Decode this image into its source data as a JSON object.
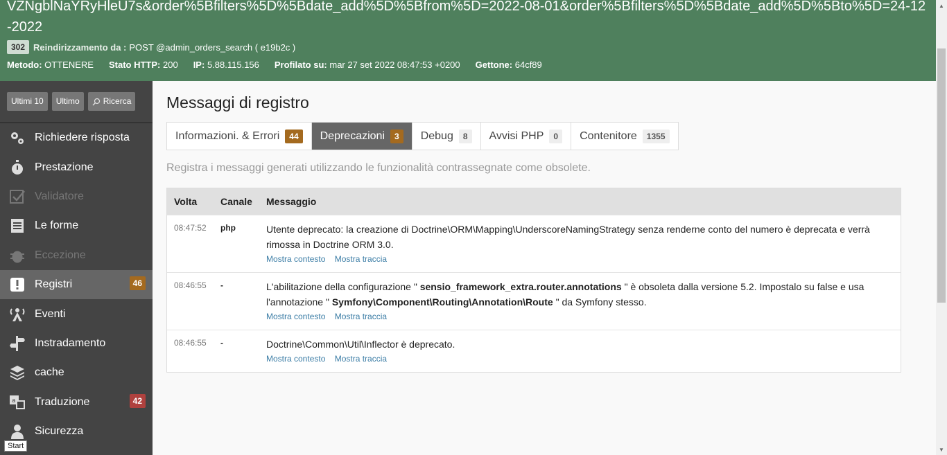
{
  "header": {
    "url": "VZNgblNaYRyHleU7s&order%5Bfilters%5D%5Bdate_add%5D%5Bfrom%5D=2022-08-01&order%5Bfilters%5D%5Bdate_add%5D%5Bto%5D=24-12-2022",
    "status_code": "302",
    "redirect_label": "Reindirizzamento da :",
    "redirect_value": "POST @admin_orders_search ( e19b2c )",
    "method_label": "Metodo:",
    "method_value": "OTTENERE",
    "http_label": "Stato HTTP:",
    "http_value": "200",
    "ip_label": "IP:",
    "ip_value": "5.88.115.156",
    "profiled_label": "Profilato su:",
    "profiled_value": "mar 27 set 2022 08:47:53 +0200",
    "token_label": "Gettone:",
    "token_value": "64cf89"
  },
  "sidebar": {
    "buttons": {
      "last10": "Ultimi 10",
      "latest": "Ultimo",
      "search": "Ricerca"
    },
    "items": [
      {
        "label": "Richiedere risposta",
        "icon": "gears-icon"
      },
      {
        "label": "Prestazione",
        "icon": "stopwatch-icon"
      },
      {
        "label": "Validatore",
        "icon": "checkbox-icon",
        "disabled": true
      },
      {
        "label": "Le forme",
        "icon": "form-icon"
      },
      {
        "label": "Eccezione",
        "icon": "bug-icon",
        "disabled": true
      },
      {
        "label": "Registri",
        "icon": "exclamation-icon",
        "count": "46",
        "active": true
      },
      {
        "label": "Eventi",
        "icon": "events-icon"
      },
      {
        "label": "Instradamento",
        "icon": "signpost-icon"
      },
      {
        "label": "cache",
        "icon": "layers-icon"
      },
      {
        "label": "Traduzione",
        "icon": "translate-icon",
        "count": "42"
      },
      {
        "label": "Sicurezza",
        "icon": "person-icon"
      }
    ],
    "start_tooltip": "Start"
  },
  "main": {
    "title": "Messaggi di registro",
    "tabs": [
      {
        "label": "Informazioni. & Errori",
        "count": "44"
      },
      {
        "label": "Deprecazioni",
        "count": "3"
      },
      {
        "label": "Debug",
        "count": "8"
      },
      {
        "label": "Avvisi PHP",
        "count": "0"
      },
      {
        "label": "Contenitore",
        "count": "1355"
      }
    ],
    "description": "Registra i messaggi generati utilizzando le funzionalità contrassegnate come obsolete.",
    "table": {
      "headers": {
        "time": "Volta",
        "channel": "Canale",
        "message": "Messaggio"
      },
      "rows": [
        {
          "time": "08:47:52",
          "channel": "php",
          "message": "Utente deprecato: la creazione di Doctrine\\ORM\\Mapping\\UnderscoreNamingStrategy senza renderne conto del numero è deprecata e verrà rimossa in Doctrine ORM 3.0."
        },
        {
          "time": "08:46:55",
          "channel": "-",
          "message_pre": "L'abilitazione della configurazione \"",
          "message_b1": "sensio_framework_extra.router.annotations",
          "message_mid": "\" è obsoleta dalla versione 5.2. Impostalo su false e usa l'annotazione \"",
          "message_b2": "Symfony\\Component\\Routing\\Annotation\\Route",
          "message_post": "\" da Symfony stesso."
        },
        {
          "time": "08:46:55",
          "channel": "-",
          "message": "Doctrine\\Common\\Util\\Inflector è deprecato."
        }
      ],
      "link_context": "Mostra contesto",
      "link_trace": "Mostra traccia"
    }
  }
}
